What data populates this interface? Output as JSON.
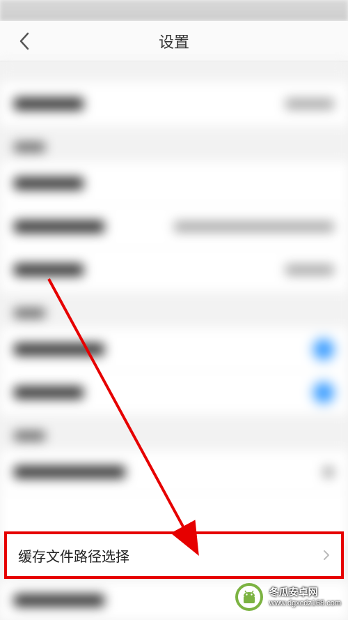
{
  "nav": {
    "title": "设置"
  },
  "highlighted_item": {
    "label": "缓存文件路径选择"
  },
  "watermark": {
    "title": "冬瓜安卓网",
    "url": "www.dgxcdz168.com"
  },
  "colors": {
    "highlight_border": "#e60000",
    "arrow": "#e60000",
    "toggle_on": "#3399ff"
  }
}
